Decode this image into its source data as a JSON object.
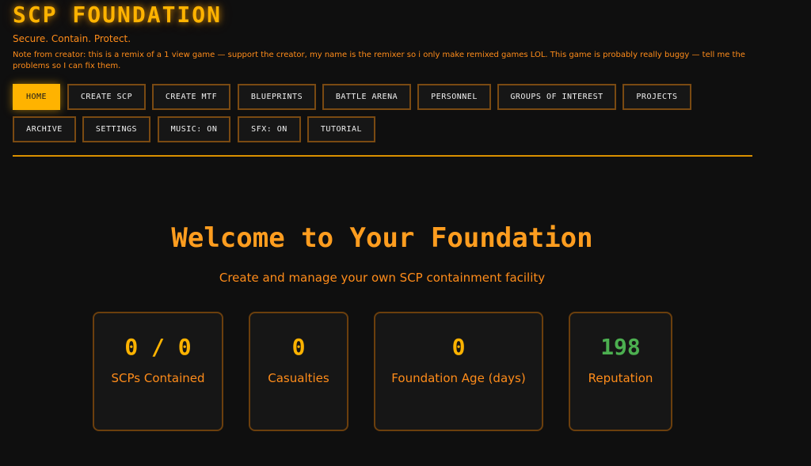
{
  "header": {
    "title": "SCP FOUNDATION",
    "tagline": "Secure. Contain. Protect.",
    "note": "Note from creator: this is a remix of a 1 view game — support the creator, my name is the remixer so i only make remixed games LOL. This game is probably really buggy — tell me the problems so I can fix them."
  },
  "nav": {
    "home": "HOME",
    "create_scp": "CREATE SCP",
    "create_mtf": "CREATE MTF",
    "blueprints": "BLUEPRINTS",
    "battle_arena": "BATTLE ARENA",
    "personnel": "PERSONNEL",
    "groups_of_interest": "GROUPS OF INTEREST",
    "projects": "PROJECTS",
    "archive": "ARCHIVE",
    "settings": "SETTINGS",
    "music": "MUSIC: ON",
    "sfx": "SFX: ON",
    "tutorial": "TUTORIAL",
    "active": "HOME"
  },
  "main": {
    "title": "Welcome to Your Foundation",
    "subtitle": "Create and manage your own SCP containment facility",
    "stats": {
      "contained": {
        "value": "0 / 0",
        "label": "SCPs Contained"
      },
      "casualties": {
        "value": "0",
        "label": "Casualties"
      },
      "age": {
        "value": "0",
        "label": "Foundation Age (days)"
      },
      "reputation": {
        "value": "198",
        "label": "Reputation"
      }
    }
  },
  "colors": {
    "accent": "#ffb300",
    "text_orange": "#ff8c1a",
    "reputation_green": "#4caf50",
    "background": "#0f0f0f",
    "card_border": "#6b3f0d"
  }
}
